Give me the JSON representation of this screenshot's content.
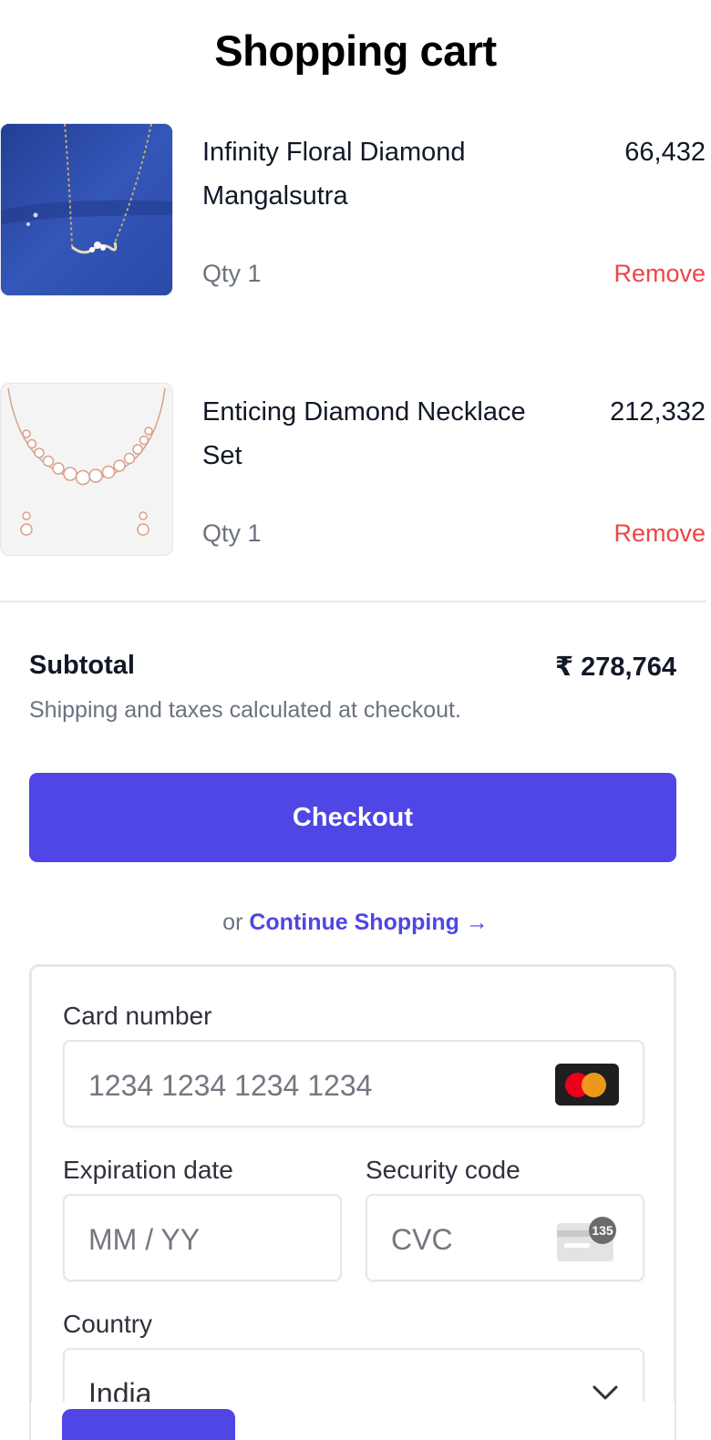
{
  "page": {
    "title": "Shopping cart"
  },
  "cart": {
    "items": [
      {
        "name": "Infinity Floral Diamond Mangalsutra",
        "price": "66,432",
        "qty": "Qty 1",
        "remove_label": "Remove",
        "image_icon": "mangalsutra-image"
      },
      {
        "name": "Enticing Diamond Necklace Set",
        "price": "212,332",
        "qty": "Qty 1",
        "remove_label": "Remove",
        "image_icon": "necklace-set-image"
      }
    ]
  },
  "summary": {
    "subtotal_label": "Subtotal",
    "subtotal_value": "₹ 278,764",
    "note": "Shipping and taxes calculated at checkout.",
    "checkout_label": "Checkout",
    "continue_prefix": "or",
    "continue_label": "Continue Shopping →"
  },
  "payment": {
    "card_number_label": "Card number",
    "card_number_placeholder": "1234 1234 1234 1234",
    "card_brand_icon": "mastercard-icon",
    "expiry_label": "Expiration date",
    "expiry_placeholder": "MM / YY",
    "cvc_label": "Security code",
    "cvc_placeholder": "CVC",
    "cvc_icon_text": "135",
    "country_label": "Country",
    "country_value": "India"
  },
  "colors": {
    "accent": "#4f46e5",
    "remove": "#ef4444",
    "muted": "#6b7280",
    "text": "#111827"
  }
}
